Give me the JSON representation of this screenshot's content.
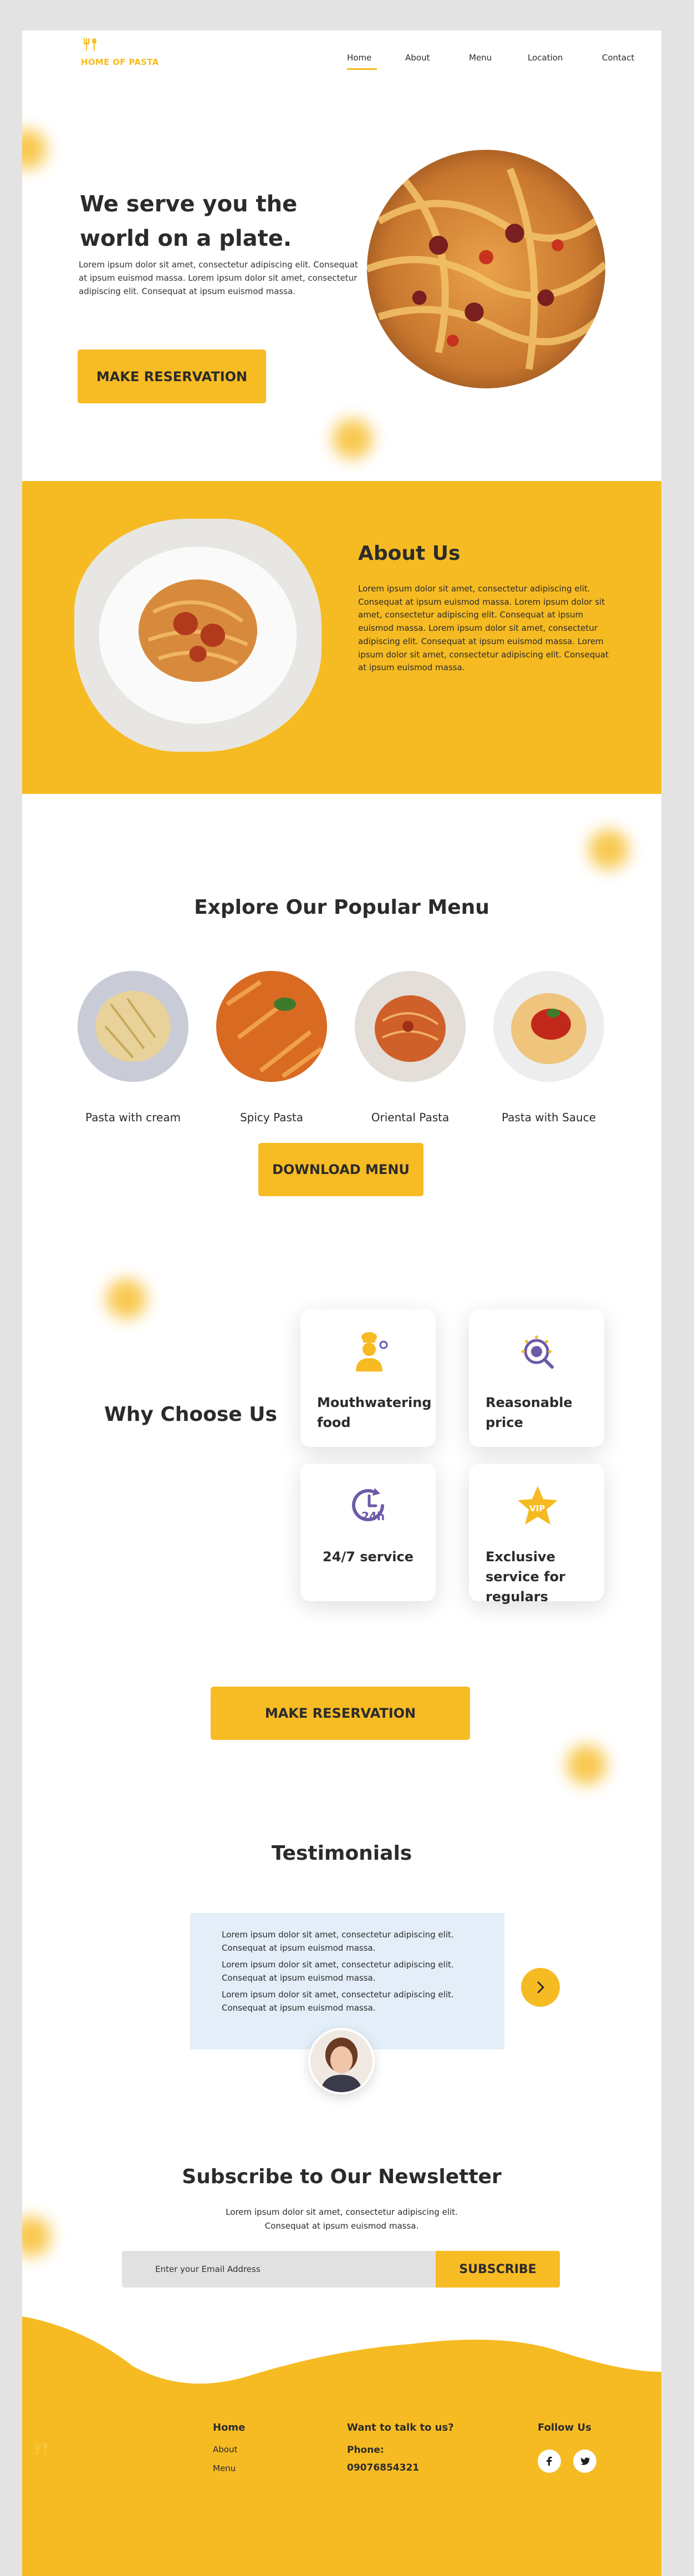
{
  "header": {
    "brand": "HOME OF PASTA",
    "nav": [
      "Home",
      "About",
      "Menu",
      "Location",
      "Contact"
    ],
    "active_nav": "Home"
  },
  "hero": {
    "title": "We serve you the world on a plate.",
    "body": "Lorem ipsum dolor sit amet, consectetur adipiscing elit. Consequat at ipsum euismod massa. Lorem ipsum dolor sit amet, consectetur adipiscing elit. Consequat at ipsum euismod massa.",
    "button": "MAKE RESERVATION"
  },
  "about": {
    "title": "About Us",
    "body": "Lorem ipsum dolor sit amet, consectetur adipiscing elit. Consequat at ipsum euismod massa. Lorem ipsum dolor sit amet, consectetur adipiscing elit. Consequat at ipsum euismod massa. Lorem ipsum dolor sit amet, consectetur adipiscing elit. Consequat at ipsum euismod massa. Lorem ipsum dolor sit amet, consectetur adipiscing elit. Consequat at ipsum euismod massa."
  },
  "menu": {
    "title": "Explore Our Popular Menu",
    "items": [
      "Pasta with cream",
      "Spicy Pasta",
      "Oriental Pasta",
      "Pasta with Sauce"
    ],
    "button": "DOWNLOAD MENU"
  },
  "why": {
    "title": "Why Choose Us",
    "cards": [
      {
        "label": "Mouthwatering food",
        "icon": "chef-icon"
      },
      {
        "label": "Reasonable price",
        "icon": "price-tag-icon"
      },
      {
        "label": "24/7 service",
        "icon": "clock-24h-icon"
      },
      {
        "label": "Exclusive service for regulars",
        "icon": "vip-star-icon"
      }
    ],
    "button": "MAKE RESERVATION",
    "icon_text": {
      "hours": "24h",
      "vip": "VIP"
    }
  },
  "testimonials": {
    "title": "Testimonials",
    "quote": [
      "Lorem ipsum dolor sit amet, consectetur adipiscing elit. Consequat at ipsum euismod massa.",
      "Lorem ipsum dolor sit amet, consectetur adipiscing elit. Consequat at ipsum euismod massa.",
      "Lorem ipsum dolor sit amet, consectetur adipiscing elit. Consequat at ipsum euismod massa."
    ]
  },
  "newsletter": {
    "title": "Subscribe to Our Newsletter",
    "body": "Lorem ipsum dolor sit amet, consectetur adipiscing elit. Consequat at ipsum euismod massa.",
    "placeholder": "Enter your Email Address",
    "button": "SUBSCRIBE"
  },
  "footer": {
    "nav_head": "Home",
    "nav_links": [
      "About",
      "Menu"
    ],
    "contact_head": "Want to talk to us?",
    "phone_label": "Phone:",
    "phone": "09076854321",
    "follow_head": "Follow Us"
  },
  "colors": {
    "accent": "#f6bb22",
    "testimonial_bg": "#e3eef8",
    "icon_purple": "#6c5aa8"
  }
}
